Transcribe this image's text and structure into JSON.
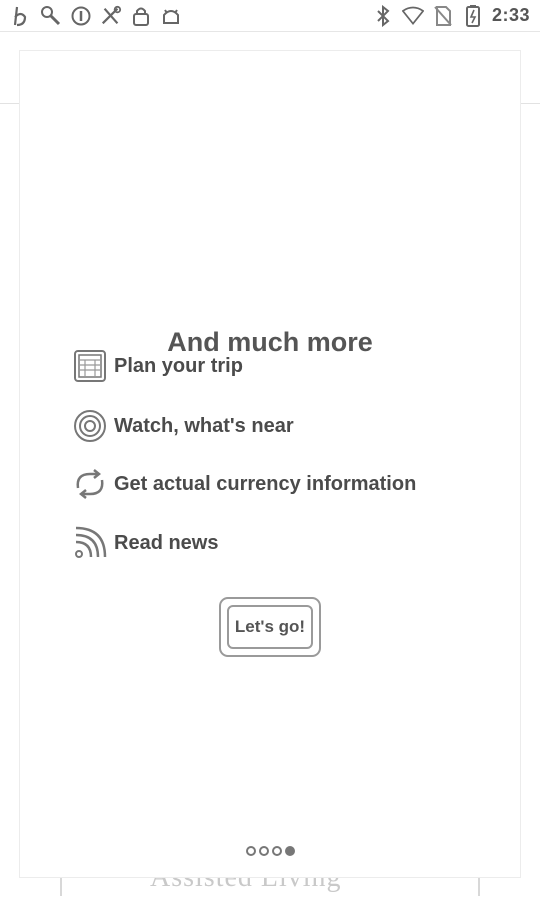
{
  "status_bar": {
    "time": "2:33",
    "left_icons": [
      "b-app-icon",
      "wrench-icon",
      "circle-i-icon",
      "tools-icon",
      "lock-icon",
      "android-icon"
    ],
    "right_icons": [
      "bluetooth-icon",
      "wifi-icon",
      "no-sim-icon",
      "battery-icon"
    ]
  },
  "background": {
    "footer_text": "Assisted Living"
  },
  "dialog": {
    "title": "And much more",
    "features": [
      {
        "label": "Plan your trip",
        "icon": "calendar-grid-icon"
      },
      {
        "label": "Watch, what's near",
        "icon": "target-icon"
      },
      {
        "label": "Get actual currency information",
        "icon": "exchange-icon"
      },
      {
        "label": "Read news",
        "icon": "rss-icon"
      }
    ],
    "button_label": "Let's go!",
    "page_count": 4,
    "active_page": 4
  }
}
